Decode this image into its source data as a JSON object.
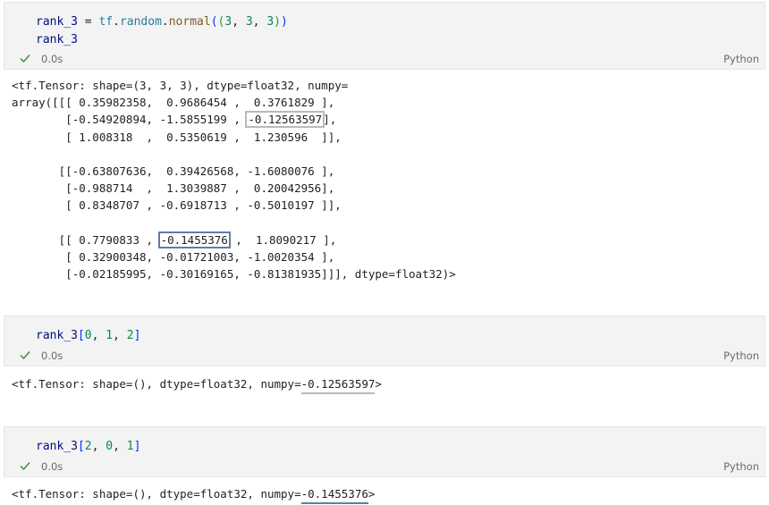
{
  "cells": [
    {
      "code_line1": {
        "var": "rank_3",
        "op": " = ",
        "mod": "tf",
        "dot1": ".",
        "sub": "random",
        "dot2": ".",
        "fn": "normal",
        "open1": "(",
        "open2": "(",
        "n1": "3",
        "c1": ", ",
        "n2": "3",
        "c2": ", ",
        "n3": "3",
        "close2": ")",
        "close1": ")"
      },
      "code_line2": "rank_3",
      "time": "0.0s",
      "lang": "Python"
    },
    {
      "code": {
        "var": "rank_3",
        "open": "[",
        "i0": "0",
        "c1": ", ",
        "i1": "1",
        "c2": ", ",
        "i2": "2",
        "close": "]"
      },
      "time": "0.0s",
      "lang": "Python"
    },
    {
      "code": {
        "var": "rank_3",
        "open": "[",
        "i0": "2",
        "c1": ", ",
        "i1": "0",
        "c2": ", ",
        "i2": "1",
        "close": "]"
      },
      "time": "0.0s",
      "lang": "Python"
    }
  ],
  "output1": {
    "line1": "<tf.Tensor: shape=(3, 3, 3), dtype=float32, numpy=",
    "line2": "array([[[ 0.35982358,  0.9686454 ,  0.3761829 ],",
    "line3_pre": "        [-0.54920894, -1.5855199 , ",
    "line3_hl": "-0.12563597",
    "line3_post": "],",
    "line4": "        [ 1.008318  ,  0.5350619 ,  1.230596  ]],",
    "line5": "",
    "line6": "       [[-0.63807636,  0.39426568, -1.6080076 ],",
    "line7": "        [-0.988714  ,  1.3039887 ,  0.20042956],",
    "line8": "        [ 0.8348707 , -0.6918713 , -0.5010197 ]],",
    "line9": "",
    "line10_pre": "       [[ 0.7790833 , ",
    "line10_hl": "-0.1455376",
    "line10_post": " ,  1.8090217 ],",
    "line11": "        [ 0.32900348, -0.01721003, -1.0020354 ],",
    "line12": "        [-0.02185995, -0.30169165, -0.81381935]]], dtype=float32)>"
  },
  "output2": {
    "pre": "<tf.Tensor: shape=(), dtype=float32, numpy=",
    "val": "-0.12563597",
    "post": ">"
  },
  "output3": {
    "pre": "<tf.Tensor: shape=(), dtype=float32, numpy=",
    "val": "-0.1455376",
    "post": ">"
  },
  "colors": {
    "gray_highlight": "#b9b9b9",
    "blue_highlight": "#5e7ea6",
    "check": "#388a34"
  },
  "icons": {
    "status": "check-icon"
  }
}
